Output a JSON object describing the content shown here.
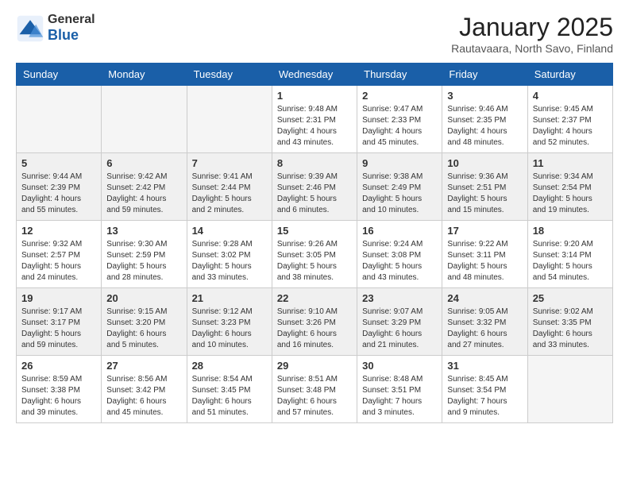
{
  "logo": {
    "general": "General",
    "blue": "Blue"
  },
  "title": "January 2025",
  "subtitle": "Rautavaara, North Savo, Finland",
  "days_of_week": [
    "Sunday",
    "Monday",
    "Tuesday",
    "Wednesday",
    "Thursday",
    "Friday",
    "Saturday"
  ],
  "weeks": [
    [
      {
        "day": "",
        "info": ""
      },
      {
        "day": "",
        "info": ""
      },
      {
        "day": "",
        "info": ""
      },
      {
        "day": "1",
        "info": "Sunrise: 9:48 AM\nSunset: 2:31 PM\nDaylight: 4 hours and 43 minutes."
      },
      {
        "day": "2",
        "info": "Sunrise: 9:47 AM\nSunset: 2:33 PM\nDaylight: 4 hours and 45 minutes."
      },
      {
        "day": "3",
        "info": "Sunrise: 9:46 AM\nSunset: 2:35 PM\nDaylight: 4 hours and 48 minutes."
      },
      {
        "day": "4",
        "info": "Sunrise: 9:45 AM\nSunset: 2:37 PM\nDaylight: 4 hours and 52 minutes."
      }
    ],
    [
      {
        "day": "5",
        "info": "Sunrise: 9:44 AM\nSunset: 2:39 PM\nDaylight: 4 hours and 55 minutes."
      },
      {
        "day": "6",
        "info": "Sunrise: 9:42 AM\nSunset: 2:42 PM\nDaylight: 4 hours and 59 minutes."
      },
      {
        "day": "7",
        "info": "Sunrise: 9:41 AM\nSunset: 2:44 PM\nDaylight: 5 hours and 2 minutes."
      },
      {
        "day": "8",
        "info": "Sunrise: 9:39 AM\nSunset: 2:46 PM\nDaylight: 5 hours and 6 minutes."
      },
      {
        "day": "9",
        "info": "Sunrise: 9:38 AM\nSunset: 2:49 PM\nDaylight: 5 hours and 10 minutes."
      },
      {
        "day": "10",
        "info": "Sunrise: 9:36 AM\nSunset: 2:51 PM\nDaylight: 5 hours and 15 minutes."
      },
      {
        "day": "11",
        "info": "Sunrise: 9:34 AM\nSunset: 2:54 PM\nDaylight: 5 hours and 19 minutes."
      }
    ],
    [
      {
        "day": "12",
        "info": "Sunrise: 9:32 AM\nSunset: 2:57 PM\nDaylight: 5 hours and 24 minutes."
      },
      {
        "day": "13",
        "info": "Sunrise: 9:30 AM\nSunset: 2:59 PM\nDaylight: 5 hours and 28 minutes."
      },
      {
        "day": "14",
        "info": "Sunrise: 9:28 AM\nSunset: 3:02 PM\nDaylight: 5 hours and 33 minutes."
      },
      {
        "day": "15",
        "info": "Sunrise: 9:26 AM\nSunset: 3:05 PM\nDaylight: 5 hours and 38 minutes."
      },
      {
        "day": "16",
        "info": "Sunrise: 9:24 AM\nSunset: 3:08 PM\nDaylight: 5 hours and 43 minutes."
      },
      {
        "day": "17",
        "info": "Sunrise: 9:22 AM\nSunset: 3:11 PM\nDaylight: 5 hours and 48 minutes."
      },
      {
        "day": "18",
        "info": "Sunrise: 9:20 AM\nSunset: 3:14 PM\nDaylight: 5 hours and 54 minutes."
      }
    ],
    [
      {
        "day": "19",
        "info": "Sunrise: 9:17 AM\nSunset: 3:17 PM\nDaylight: 5 hours and 59 minutes."
      },
      {
        "day": "20",
        "info": "Sunrise: 9:15 AM\nSunset: 3:20 PM\nDaylight: 6 hours and 5 minutes."
      },
      {
        "day": "21",
        "info": "Sunrise: 9:12 AM\nSunset: 3:23 PM\nDaylight: 6 hours and 10 minutes."
      },
      {
        "day": "22",
        "info": "Sunrise: 9:10 AM\nSunset: 3:26 PM\nDaylight: 6 hours and 16 minutes."
      },
      {
        "day": "23",
        "info": "Sunrise: 9:07 AM\nSunset: 3:29 PM\nDaylight: 6 hours and 21 minutes."
      },
      {
        "day": "24",
        "info": "Sunrise: 9:05 AM\nSunset: 3:32 PM\nDaylight: 6 hours and 27 minutes."
      },
      {
        "day": "25",
        "info": "Sunrise: 9:02 AM\nSunset: 3:35 PM\nDaylight: 6 hours and 33 minutes."
      }
    ],
    [
      {
        "day": "26",
        "info": "Sunrise: 8:59 AM\nSunset: 3:38 PM\nDaylight: 6 hours and 39 minutes."
      },
      {
        "day": "27",
        "info": "Sunrise: 8:56 AM\nSunset: 3:42 PM\nDaylight: 6 hours and 45 minutes."
      },
      {
        "day": "28",
        "info": "Sunrise: 8:54 AM\nSunset: 3:45 PM\nDaylight: 6 hours and 51 minutes."
      },
      {
        "day": "29",
        "info": "Sunrise: 8:51 AM\nSunset: 3:48 PM\nDaylight: 6 hours and 57 minutes."
      },
      {
        "day": "30",
        "info": "Sunrise: 8:48 AM\nSunset: 3:51 PM\nDaylight: 7 hours and 3 minutes."
      },
      {
        "day": "31",
        "info": "Sunrise: 8:45 AM\nSunset: 3:54 PM\nDaylight: 7 hours and 9 minutes."
      },
      {
        "day": "",
        "info": ""
      }
    ]
  ]
}
